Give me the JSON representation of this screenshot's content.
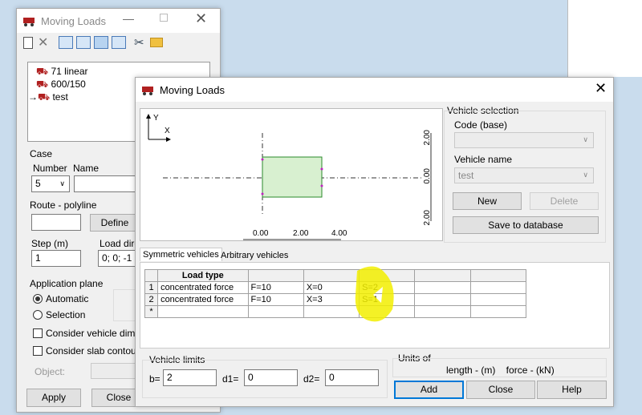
{
  "back_window": {
    "title": "Moving Loads",
    "tree_items": [
      "71 linear",
      "600/150",
      "test"
    ],
    "case_label": "Case",
    "number_label": "Number",
    "name_label": "Name",
    "number_value": "5",
    "route_label": "Route - polyline",
    "define_label": "Define",
    "step_label": "Step (m)",
    "step_value": "1",
    "load_dir_label": "Load dire",
    "load_dir_value": "0; 0; -1",
    "app_plane_label": "Application plane",
    "automatic_label": "Automatic",
    "selection_label": "Selection",
    "consider_vehicle_label": "Consider vehicle dimens",
    "consider_slab_label": "Consider slab contour",
    "object_label": "Object:",
    "apply_label": "Apply",
    "close_label": "Close"
  },
  "front_window": {
    "title": "Moving Loads",
    "preview": {
      "y_axis": "Y",
      "x_axis": "X",
      "x_ticks": [
        "0.00",
        "2.00",
        "4.00"
      ],
      "y_ticks": [
        "2.00",
        "0.00",
        "2.00"
      ]
    },
    "vehicle_selection_label": "Vehicle selection",
    "code_label": "Code (base)",
    "code_value": "",
    "vehicle_name_label": "Vehicle name",
    "vehicle_name_value": "test",
    "new_label": "New",
    "delete_label": "Delete",
    "save_db_label": "Save to database",
    "tabs": [
      "Symmetric vehicles",
      "Arbitrary vehicles"
    ],
    "grid_header": "Load type",
    "grid_rows": [
      {
        "num": "1",
        "type": "concentrated force",
        "f": "F=10",
        "x": "X=0",
        "s": "S=2"
      },
      {
        "num": "2",
        "type": "concentrated force",
        "f": "F=10",
        "x": "X=3",
        "s": "S=1"
      },
      {
        "num": "*",
        "type": "",
        "f": "",
        "x": "",
        "s": ""
      }
    ],
    "vehicle_limits_label": "Vehicle limits",
    "b_label": "b=",
    "b_value": "2",
    "d1_label": "d1=",
    "d1_value": "0",
    "d2_label": "d2=",
    "d2_value": "0",
    "units_label": "Units of",
    "units_text": "length - (m)    force - (kN)",
    "add_label": "Add",
    "close_label": "Close",
    "help_label": "Help"
  },
  "colors": {
    "highlight": "#f2ee00",
    "vehicle_fill": "#d8f0d0",
    "vehicle_stroke": "#2a8a2a",
    "marker": "#c020c0"
  }
}
